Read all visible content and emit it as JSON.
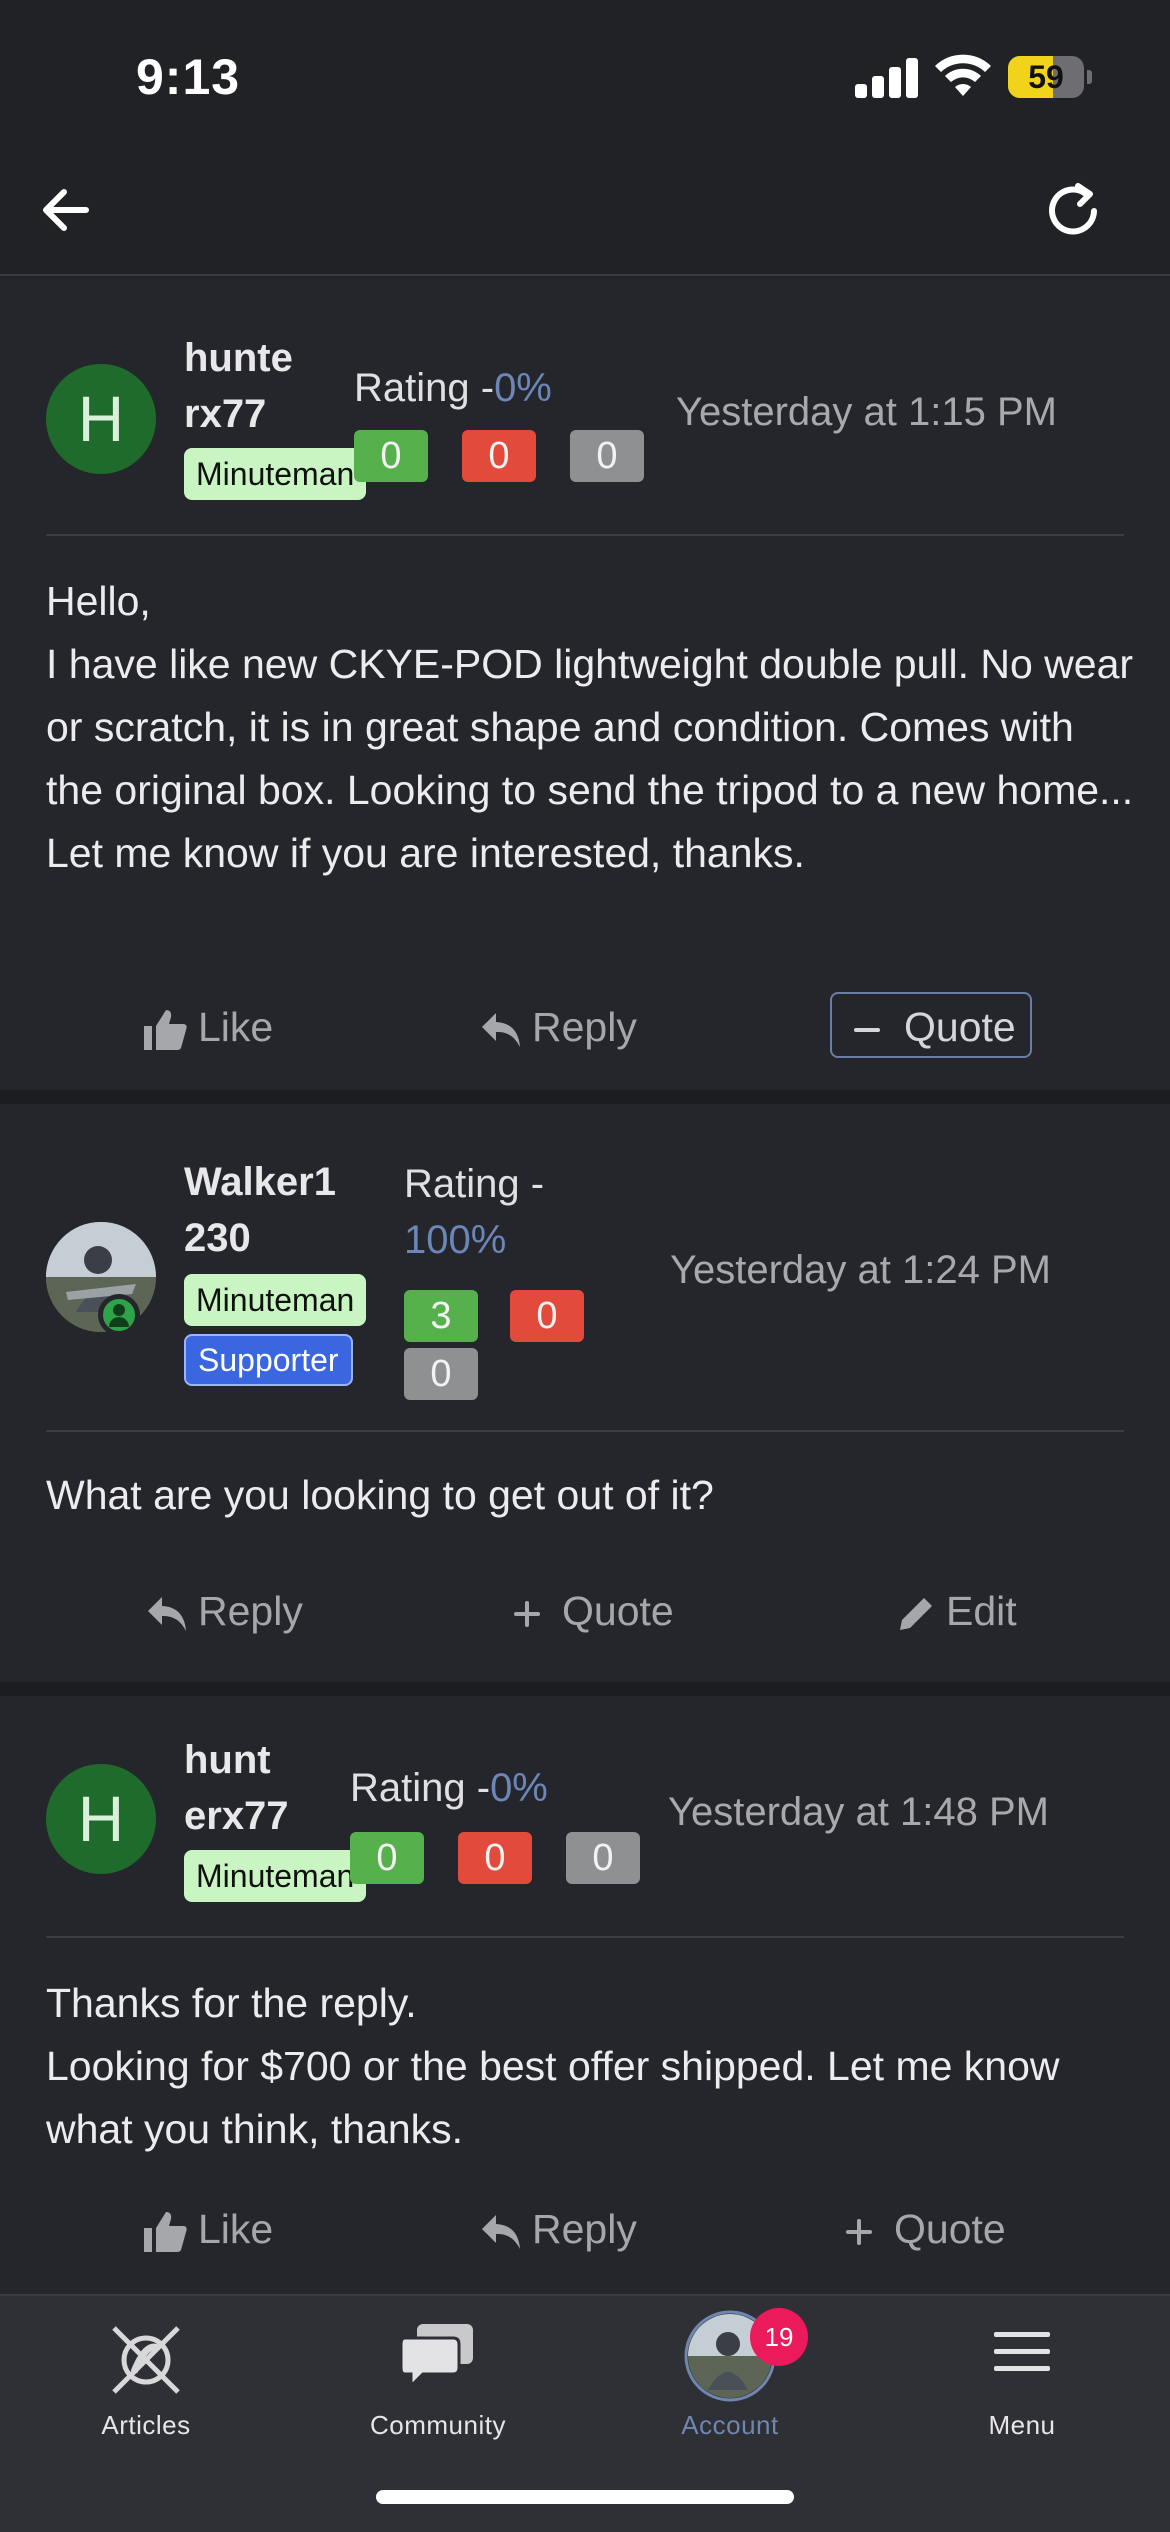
{
  "status_bar": {
    "time": "9:13",
    "battery": "59",
    "battery_level": 0.59
  },
  "nav": {
    "back_icon": "arrow-left-icon",
    "refresh_icon": "refresh-icon"
  },
  "posts": [
    {
      "avatar_letter": "H",
      "username_line1": "hunte",
      "username_line2": "rx77",
      "badge": "Minuteman",
      "rating_label": "Rating -",
      "rating_pct": "0%",
      "scores": [
        "0",
        "0",
        "0"
      ],
      "time": "Yesterday at 1:15 PM",
      "body": [
        "Hello,",
        "I have like new CKYE-POD lightweight double pull. No wear or scratch, it is in great shape and condition. Comes with the original box. Looking to send the tripod to a new home... Let me know if you are interested, thanks."
      ],
      "actions": {
        "like": "Like",
        "reply": "Reply",
        "quote": "Quote"
      }
    },
    {
      "username_line1": "Walker1",
      "username_line2": "230",
      "badge": "Minuteman",
      "badge2": "Supporter",
      "rating_label": "Rating -",
      "rating_pct": "100%",
      "scores": [
        "3",
        "0",
        "0"
      ],
      "time": "Yesterday at 1:24 PM",
      "body": [
        "What are you looking to get out of it?"
      ],
      "actions": {
        "reply": "Reply",
        "quote": "Quote",
        "edit": "Edit"
      }
    },
    {
      "avatar_letter": "H",
      "username_line1": "hunt",
      "username_line2": "erx77",
      "badge": "Minuteman",
      "rating_label": "Rating -",
      "rating_pct": "0%",
      "scores": [
        "0",
        "0",
        "0"
      ],
      "time": "Yesterday at 1:48 PM",
      "body": [
        "Thanks for the reply.",
        "Looking for $700 or the best offer shipped. Let me know what you think, thanks."
      ],
      "actions": {
        "like": "Like",
        "reply": "Reply",
        "quote": "Quote"
      }
    }
  ],
  "tab_bar": {
    "tabs": [
      {
        "label": "Articles",
        "icon": "articles-logo-icon"
      },
      {
        "label": "Community",
        "icon": "chat-bubbles-icon"
      },
      {
        "label": "Account",
        "icon": "account-avatar-icon",
        "badge": "19",
        "active": true
      },
      {
        "label": "Menu",
        "icon": "hamburger-menu-icon"
      }
    ]
  },
  "colors": {
    "background": "#212226",
    "post_background": "#25262b",
    "rating_accent": "#6b86b8",
    "positive": "#56b04c",
    "negative": "#e24a3b",
    "neutral": "#8f9092",
    "minuteman_badge": "#c8f5c2",
    "supporter_badge": "#3a66e0",
    "notification": "#ea1a5b"
  }
}
